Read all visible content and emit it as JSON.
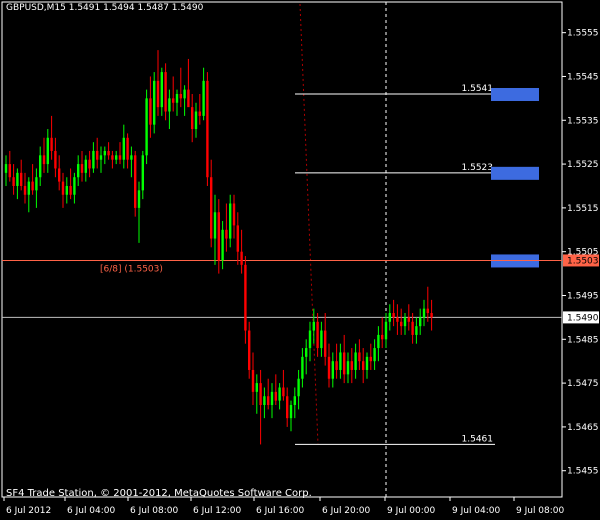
{
  "header": {
    "title": "GBPUSD,M15  1.5491 1.5494 1.5487 1.5490"
  },
  "footer": {
    "copyright": "SF4 Trade Station, © 2001-2012, MetaQuotes Software Corp."
  },
  "colors": {
    "background": "#000000",
    "bull": "#00ff00",
    "bear": "#ff0000",
    "grid": "#ffffff",
    "level_box": "#3d6be0",
    "murrey": "#ff6347"
  },
  "chart_data": {
    "type": "candlestick",
    "symbol": "GBPUSD",
    "timeframe": "M15",
    "ylim": [
      1.5449,
      1.5562
    ],
    "y_ticks": [
      "1.5555",
      "1.5545",
      "1.5535",
      "1.5525",
      "1.5515",
      "1.5505",
      "1.5495",
      "1.5485",
      "1.5475",
      "1.5465",
      "1.5455"
    ],
    "x_ticks": [
      "6 Jul 2012",
      "6 Jul 04:00",
      "6 Jul 08:00",
      "6 Jul 12:00",
      "6 Jul 16:00",
      "6 Jul 20:00",
      "9 Jul 00:00",
      "9 Jul 04:00",
      "9 Jul 08:00"
    ],
    "current_price": "1.5490",
    "murrey_level": {
      "text": "[6/8]  (1.5503)",
      "price": 1.5503,
      "price_label": "1.5503"
    },
    "levels": [
      {
        "label": "1.5541",
        "price": 1.5541
      },
      {
        "label": "1.5523",
        "price": 1.5523
      },
      {
        "label": "1.5461",
        "price": 1.5461
      }
    ],
    "boxes": [
      1.5541,
      1.5523,
      1.5503
    ],
    "candles": [
      [
        1.5523,
        1.5527,
        1.552,
        1.5525
      ],
      [
        1.5525,
        1.5528,
        1.5521,
        1.5522
      ],
      [
        1.5522,
        1.5525,
        1.5518,
        1.552
      ],
      [
        1.552,
        1.5524,
        1.5517,
        1.5523
      ],
      [
        1.5523,
        1.5526,
        1.5519,
        1.552
      ],
      [
        1.552,
        1.5523,
        1.5516,
        1.5518
      ],
      [
        1.5518,
        1.5522,
        1.5514,
        1.5521
      ],
      [
        1.5521,
        1.5525,
        1.5518,
        1.5519
      ],
      [
        1.5519,
        1.5524,
        1.5515,
        1.5522
      ],
      [
        1.5522,
        1.5529,
        1.552,
        1.5527
      ],
      [
        1.5527,
        1.5531,
        1.5523,
        1.5525
      ],
      [
        1.5525,
        1.5533,
        1.5523,
        1.5531
      ],
      [
        1.5531,
        1.5536,
        1.5526,
        1.5528
      ],
      [
        1.5528,
        1.5531,
        1.5522,
        1.5524
      ],
      [
        1.5524,
        1.5527,
        1.5519,
        1.5521
      ],
      [
        1.5521,
        1.5523,
        1.5515,
        1.5518
      ],
      [
        1.5518,
        1.5522,
        1.5516,
        1.552
      ],
      [
        1.552,
        1.5524,
        1.5517,
        1.5518
      ],
      [
        1.5518,
        1.5523,
        1.5516,
        1.5522
      ],
      [
        1.5522,
        1.5527,
        1.552,
        1.5525
      ],
      [
        1.5525,
        1.5528,
        1.5521,
        1.5523
      ],
      [
        1.5523,
        1.5527,
        1.5521,
        1.5526
      ],
      [
        1.5526,
        1.5528,
        1.5522,
        1.5524
      ],
      [
        1.5524,
        1.553,
        1.5523,
        1.5528
      ],
      [
        1.5528,
        1.5531,
        1.5524,
        1.5526
      ],
      [
        1.5526,
        1.5529,
        1.5523,
        1.5527
      ],
      [
        1.5527,
        1.5529,
        1.5525,
        1.5528
      ],
      [
        1.5528,
        1.553,
        1.5526,
        1.5527
      ],
      [
        1.5527,
        1.5528,
        1.5524,
        1.5526
      ],
      [
        1.5526,
        1.5528,
        1.5525,
        1.5527
      ],
      [
        1.5527,
        1.553,
        1.5525,
        1.5526
      ],
      [
        1.5526,
        1.5534,
        1.5524,
        1.5531
      ],
      [
        1.5531,
        1.5532,
        1.5524,
        1.5526
      ],
      [
        1.5526,
        1.5529,
        1.5522,
        1.5527
      ],
      [
        1.5527,
        1.5528,
        1.5513,
        1.5515
      ],
      [
        1.5515,
        1.5521,
        1.5507,
        1.5519
      ],
      [
        1.5519,
        1.5528,
        1.5517,
        1.5527
      ],
      [
        1.5527,
        1.5542,
        1.5525,
        1.554
      ],
      [
        1.554,
        1.5545,
        1.5531,
        1.5534
      ],
      [
        1.5534,
        1.5546,
        1.5532,
        1.5544
      ],
      [
        1.5544,
        1.5551,
        1.5536,
        1.5538
      ],
      [
        1.5538,
        1.5547,
        1.5536,
        1.5546
      ],
      [
        1.5546,
        1.5548,
        1.5535,
        1.5537
      ],
      [
        1.5537,
        1.5542,
        1.5533,
        1.554
      ],
      [
        1.554,
        1.5545,
        1.5537,
        1.5539
      ],
      [
        1.5539,
        1.5542,
        1.5536,
        1.5541
      ],
      [
        1.5541,
        1.5547,
        1.5538,
        1.554
      ],
      [
        1.554,
        1.5543,
        1.5536,
        1.5542
      ],
      [
        1.5542,
        1.5549,
        1.554,
        1.5538
      ],
      [
        1.5538,
        1.5541,
        1.553,
        1.5533
      ],
      [
        1.5533,
        1.5539,
        1.5531,
        1.5537
      ],
      [
        1.5537,
        1.5541,
        1.5534,
        1.5536
      ],
      [
        1.5536,
        1.5547,
        1.5535,
        1.5544
      ],
      [
        1.5544,
        1.5546,
        1.552,
        1.5522
      ],
      [
        1.5522,
        1.5526,
        1.5506,
        1.5508
      ],
      [
        1.5508,
        1.5518,
        1.5502,
        1.5514
      ],
      [
        1.5514,
        1.5517,
        1.55,
        1.5503
      ],
      [
        1.5503,
        1.5512,
        1.5501,
        1.551
      ],
      [
        1.551,
        1.5516,
        1.5505,
        1.5508
      ],
      [
        1.5508,
        1.5518,
        1.5506,
        1.5516
      ],
      [
        1.5516,
        1.5518,
        1.5508,
        1.5511
      ],
      [
        1.5511,
        1.5514,
        1.5502,
        1.5505
      ],
      [
        1.5505,
        1.551,
        1.55,
        1.5502
      ],
      [
        1.5502,
        1.5504,
        1.5484,
        1.5487
      ],
      [
        1.5487,
        1.5489,
        1.5476,
        1.5478
      ],
      [
        1.5478,
        1.5482,
        1.547,
        1.5473
      ],
      [
        1.5473,
        1.5477,
        1.5468,
        1.5475
      ],
      [
        1.5475,
        1.5478,
        1.5461,
        1.547
      ],
      [
        1.547,
        1.5474,
        1.5467,
        1.5472
      ],
      [
        1.5472,
        1.5476,
        1.5469,
        1.547
      ],
      [
        1.547,
        1.5475,
        1.5467,
        1.5473
      ],
      [
        1.5473,
        1.5477,
        1.547,
        1.5471
      ],
      [
        1.5471,
        1.5475,
        1.5469,
        1.5474
      ],
      [
        1.5474,
        1.5478,
        1.5471,
        1.5472
      ],
      [
        1.5472,
        1.5474,
        1.5465,
        1.5467
      ],
      [
        1.5467,
        1.5471,
        1.5464,
        1.547
      ],
      [
        1.547,
        1.5474,
        1.5467,
        1.5472
      ],
      [
        1.5472,
        1.5478,
        1.5469,
        1.5476
      ],
      [
        1.5476,
        1.5483,
        1.5474,
        1.5481
      ],
      [
        1.5481,
        1.5485,
        1.5477,
        1.5483
      ],
      [
        1.5483,
        1.5489,
        1.548,
        1.5487
      ],
      [
        1.5487,
        1.5492,
        1.5484,
        1.5489
      ],
      [
        1.5489,
        1.5491,
        1.5481,
        1.5483
      ],
      [
        1.5483,
        1.5489,
        1.5481,
        1.5487
      ],
      [
        1.5487,
        1.5491,
        1.5479,
        1.5481
      ],
      [
        1.5481,
        1.5484,
        1.5474,
        1.5476
      ],
      [
        1.5476,
        1.5482,
        1.5474,
        1.548
      ],
      [
        1.548,
        1.5484,
        1.5476,
        1.5478
      ],
      [
        1.5478,
        1.5484,
        1.5476,
        1.5482
      ],
      [
        1.5482,
        1.5486,
        1.5475,
        1.5477
      ],
      [
        1.5477,
        1.5482,
        1.5475,
        1.548
      ],
      [
        1.548,
        1.5483,
        1.5475,
        1.5478
      ],
      [
        1.5478,
        1.5484,
        1.5476,
        1.5482
      ],
      [
        1.5482,
        1.5485,
        1.5478,
        1.548
      ],
      [
        1.548,
        1.5483,
        1.5475,
        1.5478
      ],
      [
        1.5478,
        1.5482,
        1.5476,
        1.5481
      ],
      [
        1.5481,
        1.5484,
        1.5478,
        1.548
      ],
      [
        1.548,
        1.5485,
        1.5478,
        1.5483
      ],
      [
        1.5483,
        1.5488,
        1.548,
        1.5486
      ],
      [
        1.5486,
        1.549,
        1.5483,
        1.5485
      ],
      [
        1.5485,
        1.5491,
        1.5483,
        1.5489
      ],
      [
        1.5489,
        1.5493,
        1.5487,
        1.5491
      ],
      [
        1.5491,
        1.5494,
        1.5488,
        1.549
      ],
      [
        1.549,
        1.5493,
        1.5486,
        1.5489
      ],
      [
        1.5489,
        1.5492,
        1.5486,
        1.5488
      ],
      [
        1.5488,
        1.5491,
        1.5486,
        1.549
      ],
      [
        1.549,
        1.5493,
        1.5487,
        1.5489
      ],
      [
        1.5489,
        1.5491,
        1.5484,
        1.5486
      ],
      [
        1.5486,
        1.549,
        1.5484,
        1.5488
      ],
      [
        1.5488,
        1.5492,
        1.5486,
        1.549
      ],
      [
        1.549,
        1.5494,
        1.5488,
        1.5492
      ],
      [
        1.5492,
        1.5497,
        1.5489,
        1.5491
      ],
      [
        1.5491,
        1.5494,
        1.5487,
        1.549
      ]
    ]
  }
}
